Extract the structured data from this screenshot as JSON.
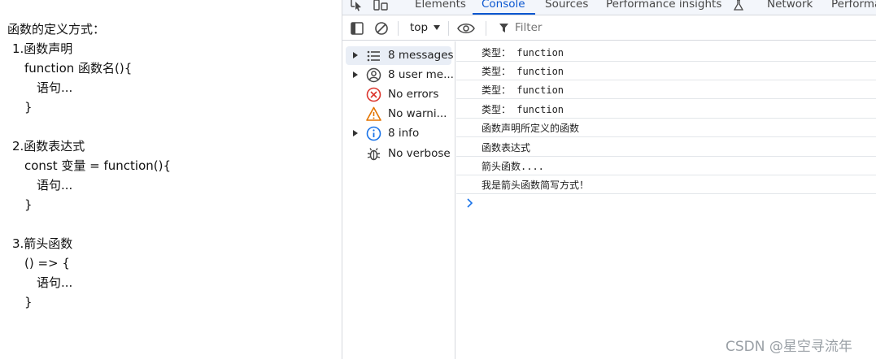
{
  "page": {
    "lines": [
      "函数的定义方式：",
      "1.函数声明",
      "function 函数名(){",
      "语句...",
      "}",
      "2.函数表达式",
      "const 变量 = function(){",
      "语句...",
      "}",
      "3.箭头函数",
      "() => {",
      "语句...",
      "}"
    ]
  },
  "devtools": {
    "tabs": [
      {
        "label": "Elements",
        "active": false
      },
      {
        "label": "Console",
        "active": true
      },
      {
        "label": "Sources",
        "active": false
      },
      {
        "label": "Performance insights",
        "active": false
      },
      {
        "label": "Network",
        "active": false
      },
      {
        "label": "Performa",
        "active": false
      }
    ],
    "toolbar": {
      "context": "top",
      "filter_placeholder": "Filter"
    },
    "sidebar": [
      {
        "label": "8 messages",
        "icon": "list-icon",
        "selected": true,
        "expandable": true
      },
      {
        "label": "8 user me...",
        "icon": "user-icon",
        "selected": false,
        "expandable": true
      },
      {
        "label": "No errors",
        "icon": "error-icon",
        "selected": false,
        "expandable": false
      },
      {
        "label": "No warni...",
        "icon": "warning-icon",
        "selected": false,
        "expandable": false
      },
      {
        "label": "8 info",
        "icon": "info-icon",
        "selected": false,
        "expandable": true
      },
      {
        "label": "No verbose",
        "icon": "bug-icon",
        "selected": false,
        "expandable": false
      }
    ],
    "messages": [
      "类型： function",
      "类型： function",
      "类型： function",
      "类型： function",
      "函数声明所定义的函数",
      "函数表达式",
      "箭头函数....",
      "我是箭头函数简写方式！"
    ],
    "colors": {
      "accent": "#0b57d0",
      "error": "#dc362e",
      "warning": "#e37400",
      "info": "#1a73e8"
    }
  },
  "watermark": "CSDN @星空寻流年"
}
